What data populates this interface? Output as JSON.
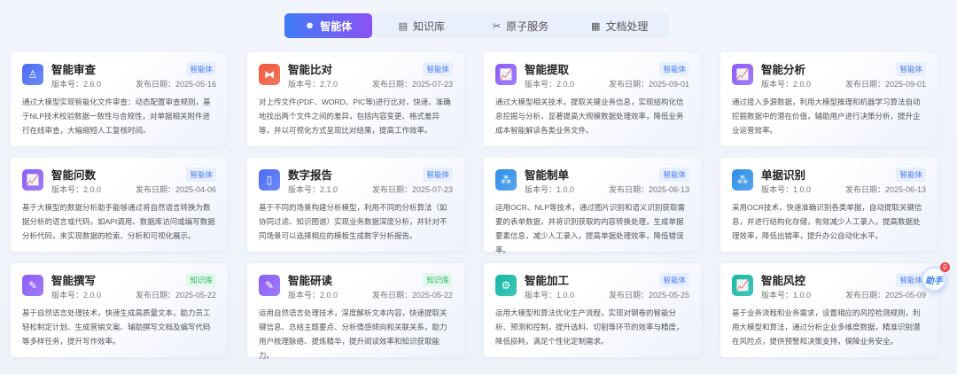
{
  "tabs": [
    {
      "label": "智能体",
      "icon": "robot-icon"
    },
    {
      "label": "知识库",
      "icon": "book-icon"
    },
    {
      "label": "原子服务",
      "icon": "tools-icon"
    },
    {
      "label": "文档处理",
      "icon": "grid-icon"
    }
  ],
  "version_prefix": "版本号：",
  "date_prefix": "发布日期：",
  "cards": [
    {
      "title": "智能审查",
      "version": "2.6.0",
      "date": "2025-05-16",
      "badge": "智能体",
      "color": "#4a6cf5",
      "icon": "stamp-icon",
      "desc": "通过大模型实现智能化文件审查：动态配置审查规则，基于NLP技术校验数据一致性与合规性，对单据相关附件进行在线审查，大幅缩短人工复核时间。"
    },
    {
      "title": "智能比对",
      "version": "2.7.0",
      "date": "2025-07-23",
      "badge": "智能体",
      "color": "#f0573a",
      "icon": "compare-icon",
      "desc": "对上传文件(PDF、WORD、PIC等)进行比对，快速、准确地找出两个文件之间的差异，包括内容变更、格式差异等，并以可视化方式呈现比对结果，提高工作效率。"
    },
    {
      "title": "智能提取",
      "version": "2.0.0",
      "date": "2025-09-01",
      "badge": "智能体",
      "color": "#8b5cf6",
      "icon": "chart-icon",
      "desc": "通过大模型相关技术，提取关键业务信息，实现结构化信息挖掘与分析，显著提高大规模数据处理效率，降低业务成本智能解读各类业务文件。"
    },
    {
      "title": "智能分析",
      "version": "2.0.0",
      "date": "2025-09-01",
      "badge": "智能体",
      "color": "#8b5cf6",
      "icon": "chart-icon",
      "desc": "通过接入多源数据，利用大模型推理和机器学习算法自动挖掘数据中的潜在价值，辅助用户进行决策分析，提升企业运营效率。"
    },
    {
      "title": "智能问数",
      "version": "2.0.0",
      "date": "2025-04-06",
      "badge": "智能体",
      "color": "#8b5cf6",
      "icon": "chart-icon",
      "desc": "基于大模型的数据分析助手能够通过将自然语言转换为数据分析的语言或代码，如API调用、数据库访问或编写数据分析代码，来实现数据的检索、分析和可视化展示。"
    },
    {
      "title": "数字报告",
      "version": "2.1.0",
      "date": "2025-07-23",
      "badge": "智能体",
      "color": "#4a6cf5",
      "icon": "report-icon",
      "desc": "基于不同的场景构建分析模型，利用不同的分析算法（如协同过滤、知识图谱）实现业务数据深度分析，并针对不同场景可以选择相应的模板生成数字分析报告。"
    },
    {
      "title": "智能制单",
      "version": "1.0.0",
      "date": "2025-06-13",
      "badge": "智能体",
      "color": "#2f8fe8",
      "icon": "cluster-icon",
      "desc": "运用OCR、NLP等技术，通过图片识别和语义识别获取需要的表单数据，并将识别获取的内容转换处理，生成单据要素信息，减少人工录入，提高单据处理效率，降低错误率。"
    },
    {
      "title": "单据识别",
      "version": "1.0.0",
      "date": "2025-06-13",
      "badge": "智能体",
      "color": "#2f8fe8",
      "icon": "cluster-icon",
      "desc": "采用OCR技术，快速准确识别各类单据，自动提取关键信息，并进行结构化存储，有效减少人工录入，提高数据处理效率，降低出错率，提升办公自动化水平。"
    },
    {
      "title": "智能撰写",
      "version": "2.0.0",
      "date": "2025-05-22",
      "badge": "知识库",
      "color": "#8b5cf6",
      "icon": "edit-icon",
      "desc": "基于自然语言处理技术，快速生成高质量文本，助力员工轻松制定计划、生成营销文案、辅助撰写文档及编写代码等多样任务，提升写作效率。"
    },
    {
      "title": "智能研读",
      "version": "2.0.0",
      "date": "2025-05-22",
      "badge": "知识库",
      "color": "#8b5cf6",
      "icon": "edit-icon",
      "desc": "运用自然语言处理技术，深度解析文本内容，快速提取关键信息、总结主题要点、分析情感倾向和关联关系，助力用户梳理脉络、提炼精华，提升阅读效率和知识获取能力。"
    },
    {
      "title": "智能加工",
      "version": "1.0.0",
      "date": "2025-05-25",
      "badge": "智能体",
      "color": "#14b8a6",
      "icon": "robot-arm-icon",
      "desc": "运用大模型和算法优化生产流程，实现对钢卷的智能分析、预测和控制，提升选料、切割等环节的效率与精度，降低损耗，满足个性化定制需求。"
    },
    {
      "title": "智能风控",
      "version": "1.0.0",
      "date": "2025-05-09",
      "badge": "智能体",
      "color": "#14b8a6",
      "icon": "chart-icon",
      "desc": "基于业务流程和业务需求，设置相应的风控检测规则，利用大模型和算法，通过分析企业多维度数据，精准识别潜在风险点，提供预警和决策支持，保障业务安全。"
    }
  ],
  "assistant": {
    "label": "助手",
    "count": "0"
  }
}
